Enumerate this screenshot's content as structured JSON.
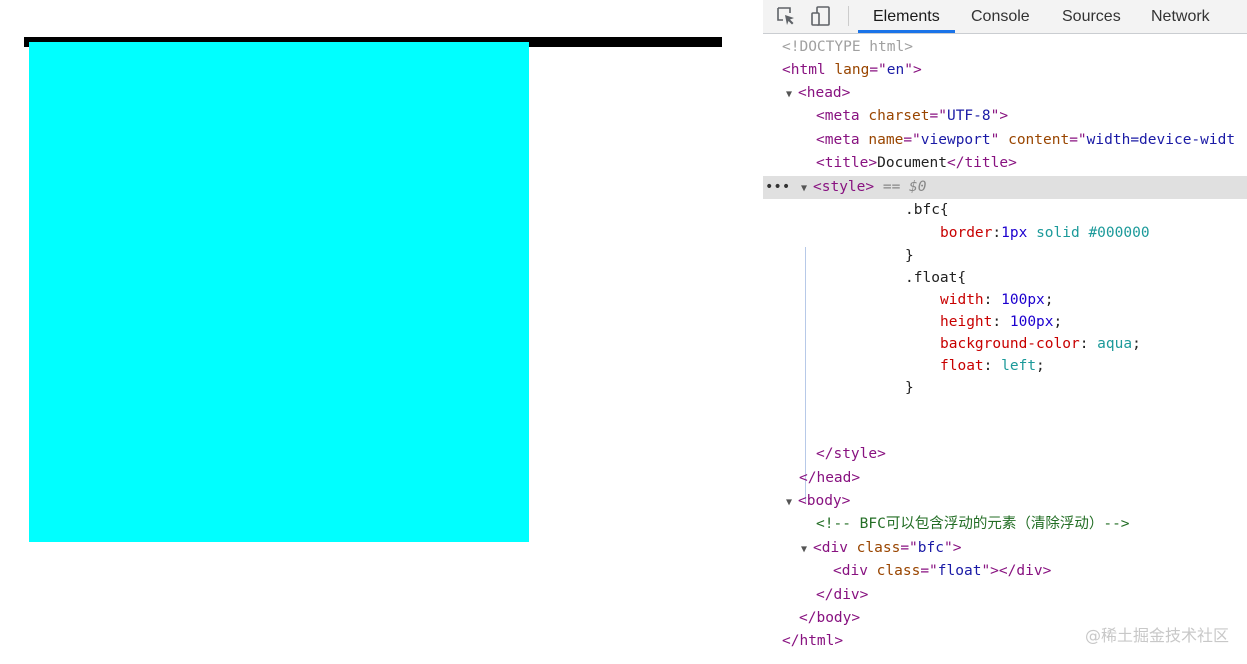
{
  "devtools": {
    "tabs": [
      {
        "label": "Elements",
        "active": true
      },
      {
        "label": "Console",
        "active": false
      },
      {
        "label": "Sources",
        "active": false
      },
      {
        "label": "Network",
        "active": false
      }
    ],
    "selected_marker": "== $0",
    "ellipsis": "•••",
    "code": {
      "doctype": "<!DOCTYPE html>",
      "html_open": {
        "tag": "html",
        "attr": "lang",
        "value": "en"
      },
      "head": "head",
      "meta_charset": {
        "tag": "meta",
        "attr": "charset",
        "value": "UTF-8"
      },
      "meta_viewport": {
        "tag": "meta",
        "attr": "name",
        "value": "viewport",
        "attr2": "content",
        "value2": "width=device-widt"
      },
      "title": {
        "tag": "title",
        "text": "Document"
      },
      "style": "style",
      "css": {
        "bfc_selector": ".bfc{",
        "border_prop": "border",
        "border_num": "1px",
        "border_rest": "solid #000000",
        "close": "}",
        "float_selector": ".float{",
        "width_prop": "width",
        "width_val": "100px",
        "height_prop": "height",
        "height_val": "100px",
        "bg_prop": "background-color",
        "bg_val": "aqua",
        "float_prop": "float",
        "float_val": "left"
      },
      "body": "body",
      "comment": "<!-- BFC可以包含浮动的元素（清除浮动）-->",
      "div_bfc": {
        "tag": "div",
        "attr": "class",
        "value": "bfc"
      },
      "div_float": {
        "tag": "div",
        "attr": "class",
        "value": "float"
      },
      "html_close": "html"
    }
  },
  "watermark": "@稀土掘金技术社区",
  "colors": {
    "float_bg": "#00ffff",
    "bfc_border": "#000000",
    "tab_active": "#1a73e8"
  }
}
